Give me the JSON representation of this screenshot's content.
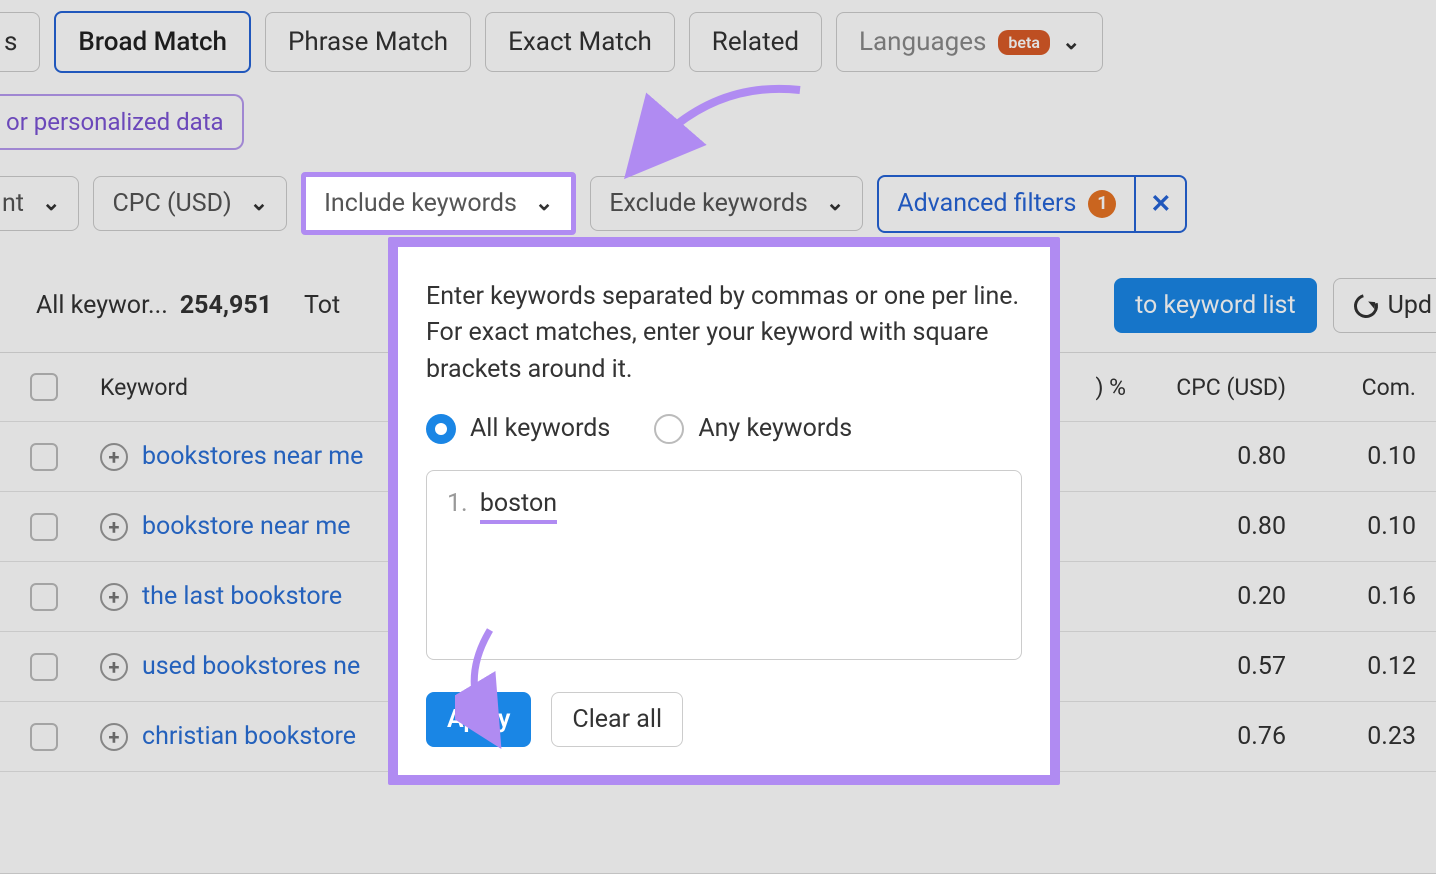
{
  "tabs": {
    "broad": "Broad Match",
    "phrase": "Phrase Match",
    "exact": "Exact Match",
    "related": "Related",
    "languages_label": "Languages",
    "languages_badge": "beta"
  },
  "personalized_hint": "or personalized data",
  "filters": {
    "nt": "nt",
    "cpc": "CPC (USD)",
    "include": "Include keywords",
    "exclude": "Exclude keywords",
    "advanced_label": "Advanced filters",
    "advanced_count": "1"
  },
  "stats": {
    "all_label": "All keywor...",
    "all_count": "254,951",
    "tot_label": "Tot"
  },
  "actions": {
    "add_to_list": "to keyword list",
    "update": "Upd"
  },
  "table": {
    "columns": {
      "keyword": "Keyword",
      "pct": ") %",
      "cpc": "CPC (USD)",
      "com": "Com."
    },
    "rows": [
      {
        "kw": "bookstores near me",
        "dot": "#b01d2e",
        "cpc": "0.80",
        "com": "0.10"
      },
      {
        "kw": "bookstore near me",
        "dot": "#b01d2e",
        "cpc": "0.80",
        "com": "0.10"
      },
      {
        "kw": "the last bookstore",
        "dot": "#d87a23",
        "cpc": "0.20",
        "com": "0.16"
      },
      {
        "kw": "used bookstores ne",
        "dot": "#e0c32e",
        "cpc": "0.57",
        "com": "0.12"
      },
      {
        "kw": "christian bookstore",
        "dot": "#d87a23",
        "cpc": "0.76",
        "com": "0.23"
      }
    ]
  },
  "popover": {
    "instructions": "Enter keywords separated by commas or one per line. For exact matches, enter your keyword with square brackets around it.",
    "radio_all": "All keywords",
    "radio_any": "Any keywords",
    "entry_num": "1.",
    "entry_val": "boston",
    "apply": "Apply",
    "clear": "Clear all"
  }
}
